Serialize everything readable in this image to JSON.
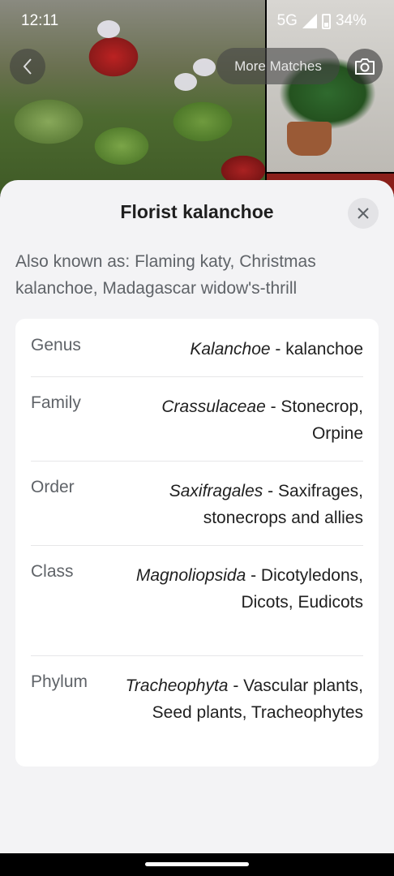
{
  "status_bar": {
    "time": "12:11",
    "network": "5G",
    "battery": "34%"
  },
  "header": {
    "more_matches_label": "More Matches"
  },
  "sheet": {
    "title": "Florist kalanchoe",
    "also_known_as": "Also known as: Flaming katy, Christmas kalanchoe, Madagascar widow's-thrill"
  },
  "taxonomy": [
    {
      "label": "Genus",
      "scientific": "Kalanchoe",
      "common": " - kalanchoe"
    },
    {
      "label": "Family",
      "scientific": "Crassulaceae",
      "common": " - Stonecrop, Orpine"
    },
    {
      "label": "Order",
      "scientific": "Saxifragales",
      "common": " - Saxifrages, stonecrops and allies"
    },
    {
      "label": "Class",
      "scientific": "Magnoliopsida",
      "common": " - Dicotyledons, Dicots, Eudicots"
    },
    {
      "label": "Phylum",
      "scientific": "Tracheophyta",
      "common": " - Vascular plants, Seed plants, Tracheophytes"
    }
  ],
  "icons": {
    "back": "chevron-left-icon",
    "camera": "camera-icon",
    "close": "close-icon",
    "signal": "signal-icon",
    "battery": "battery-icon"
  }
}
